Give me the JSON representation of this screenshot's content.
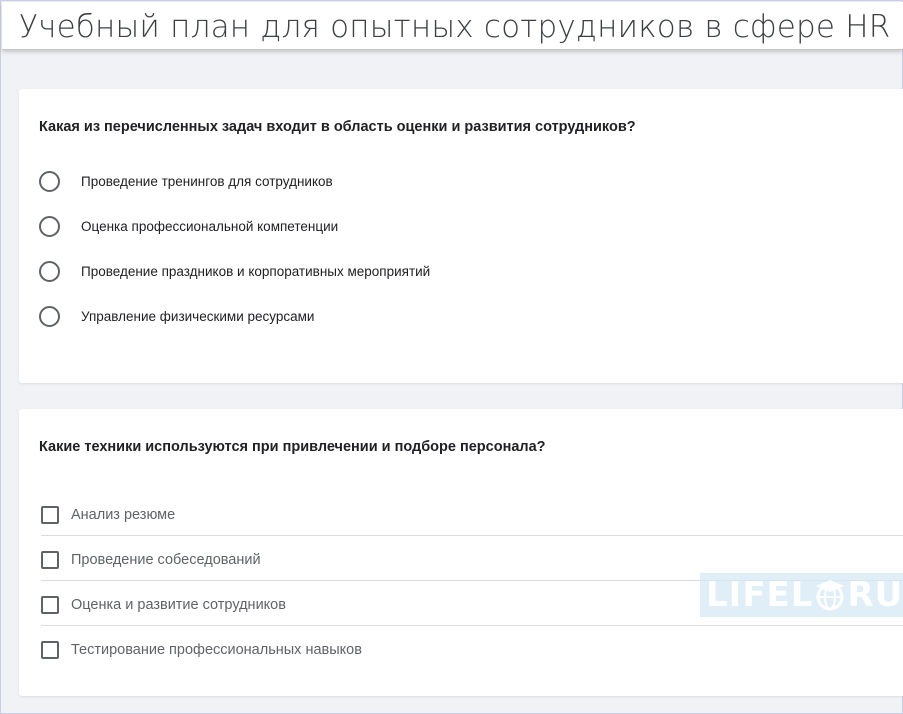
{
  "page": {
    "title": "Учебный план для опытных сотрудников в сфере HR"
  },
  "questions": [
    {
      "text": "Какая из перечисленных задач входит в область оценки и развития сотрудников?",
      "type": "radio",
      "options": [
        "Проведение тренингов для сотрудников",
        "Оценка профессиональной компетенции",
        "Проведение праздников и корпоративных мероприятий",
        "Управление физическими ресурсами"
      ]
    },
    {
      "text": "Какие техники используются при привлечении и подборе персонала?",
      "type": "checkbox",
      "options": [
        "Анализ резюме",
        "Проведение собеседований",
        "Оценка и развитие сотрудников",
        "Тестирование профессиональных навыков"
      ]
    }
  ],
  "watermark": {
    "left": "LIFEL",
    "right": "RU",
    "icon": "graduation-globe-icon"
  },
  "colors": {
    "background": "#f1f2f6",
    "card": "#ffffff",
    "control_border": "#5f6368",
    "watermark_bg": "#d6e8f6"
  }
}
